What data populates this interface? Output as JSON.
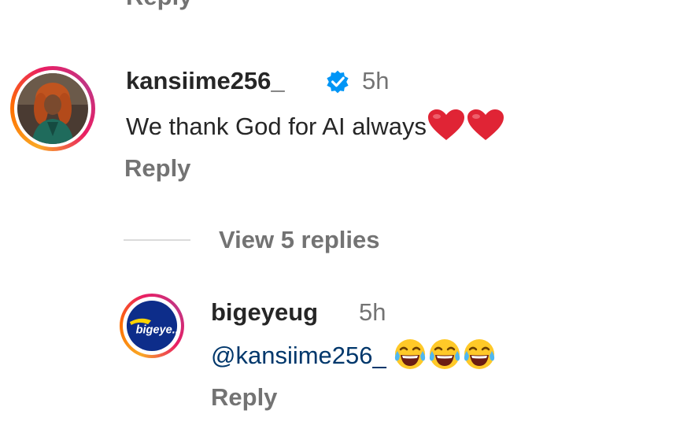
{
  "top_reply_label": "Reply",
  "comment1": {
    "username": "kansiime256_",
    "time": "5h",
    "text": "We thank God for AI always",
    "emojis": [
      "red-heart",
      "red-heart"
    ],
    "reply_label": "Reply"
  },
  "view_replies_label": "View 5 replies",
  "comment2": {
    "username": "bigeyeug",
    "time": "5h",
    "mention": "@kansiime256_",
    "emojis": [
      "tears-of-joy",
      "tears-of-joy",
      "tears-of-joy"
    ],
    "reply_label": "Reply",
    "avatar_text": "bigeye.."
  },
  "colors": {
    "verified": "#0095f6",
    "heart": "#e02435",
    "mention": "#00376b",
    "muted": "#737373"
  }
}
